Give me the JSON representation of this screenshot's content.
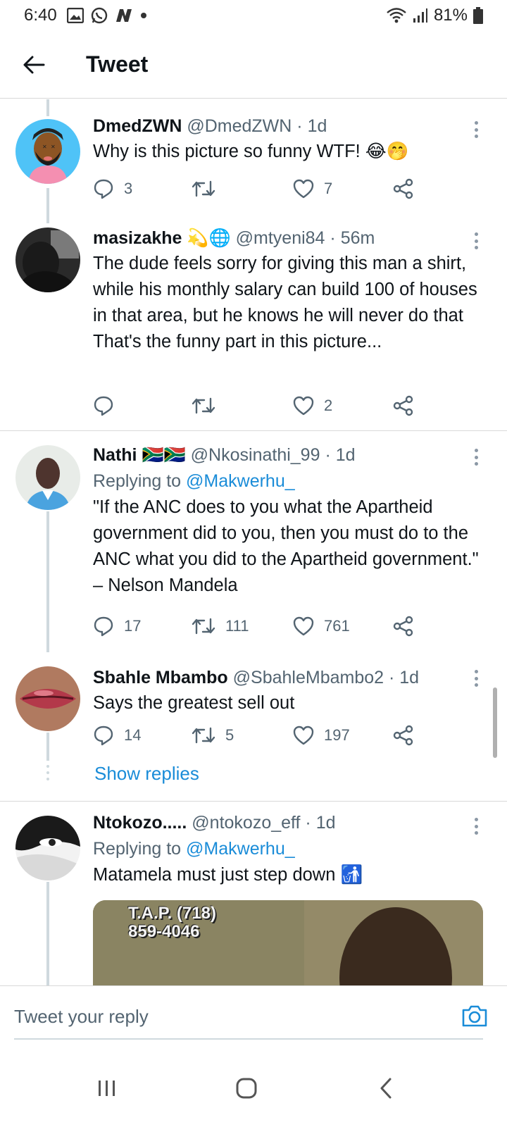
{
  "status_bar": {
    "time": "6:40",
    "battery": "81%"
  },
  "header": {
    "title": "Tweet"
  },
  "tweets": [
    {
      "name": "DmedZWN",
      "handle": "@DmedZWN",
      "time": "· 1d",
      "text": "Why is this picture so funny WTF! 😂🤭",
      "replies": "3",
      "retweets": "",
      "likes": "7"
    },
    {
      "name": "masizakhe",
      "badges": "💫🌐",
      "handle": "@mtyeni84",
      "time": "· 56m",
      "text": "The dude feels sorry for giving this man a shirt, while his monthly salary can build 100 of houses in that area, but he knows he will never do that\nThat's the funny part in this picture...",
      "replies": "",
      "retweets": "",
      "likes": "2"
    },
    {
      "name": "Nathi",
      "badges": "🇿🇦🇿🇦",
      "handle": "@Nkosinathi_99",
      "time": "· 1d",
      "replying_prefix": "Replying to",
      "replying_to": "@Makwerhu_",
      "text": "\"If the ANC does to you what the Apartheid government did to you, then you must do to the ANC what you did to the Apartheid government.\" – Nelson Mandela",
      "replies": "17",
      "retweets": "111",
      "likes": "761"
    },
    {
      "name": "Sbahle Mbambo",
      "handle": "@SbahleMbambo2",
      "time": "· 1d",
      "text": "Says the greatest sell out",
      "replies": "14",
      "retweets": "5",
      "likes": "197"
    },
    {
      "name": "Ntokozo.....",
      "handle": "@ntokozo_eff",
      "time": "· 1d",
      "replying_prefix": "Replying to",
      "replying_to": "@Makwerhu_",
      "text": "Matamela must just step down 🚮",
      "media_caption": "T.A.P. (718)\n859-4046"
    }
  ],
  "show_replies": "Show replies",
  "composer": {
    "placeholder": "Tweet your reply"
  },
  "icons": {
    "back": "arrow-left-icon",
    "more": "more-vertical-icon",
    "reply": "comment-icon",
    "retweet": "retweet-icon",
    "like": "heart-icon",
    "share": "share-icon",
    "camera": "camera-icon"
  },
  "colors": {
    "accent": "#1a8cd8",
    "secondary_text": "#536471",
    "thread_line": "#cfd9de"
  }
}
